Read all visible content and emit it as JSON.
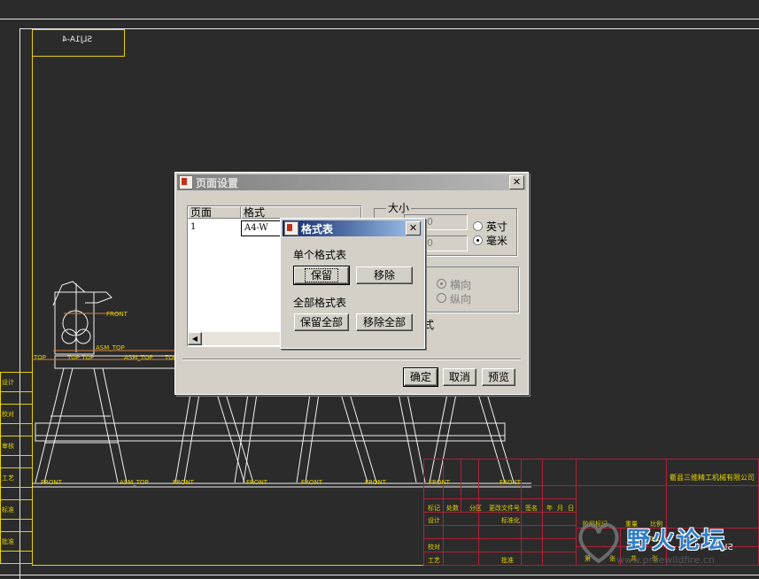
{
  "cad": {
    "drawing_name_box": "SLJ1A-4",
    "labels": {
      "front1": "FRONT",
      "asm_top1": "ASM_TOP",
      "top1": "TOP",
      "top_top": "TOP TOP",
      "asm_top2": "ASM_TOP",
      "top2": "TOP",
      "asm_top3": "ASM_TOP",
      "front2": "FRONT",
      "front3": "FRONT",
      "front4": "FRONT",
      "front5": "FRONT",
      "front6": "FRONT",
      "front7": "FRONT",
      "front8": "FRONT"
    },
    "left_title_block": [
      "设计",
      "校对",
      "审核",
      "工艺",
      "标准",
      "批准"
    ],
    "title_block": {
      "company": "衢县三维精工机械有限公司",
      "row_headers": [
        "标记",
        "处数",
        "分区",
        "更改文件号",
        "签名",
        "年",
        "月",
        "日"
      ],
      "design": "设计",
      "standardize": "标准化",
      "stage_mark": "阶段标记",
      "weight": "重量",
      "scale": "比例",
      "check": "校对",
      "process": "工艺",
      "approve": "批准",
      "sheets": "共",
      "sheet": "张",
      "sheet_label": "第",
      "sheet_label2": "张",
      "scale_value": "1:10",
      "drawing_number": "SLJ1A-4"
    }
  },
  "page_setup": {
    "title": "页面设置",
    "close": "✕",
    "table_headers": [
      "页面",
      "格式"
    ],
    "rows": [
      {
        "page": "1",
        "format": "A4-W"
      }
    ],
    "size_group": "大小",
    "width_value": "00",
    "height_value": "00",
    "unit_inch": "英寸",
    "unit_mm": "毫米",
    "orient_landscape": "横向",
    "orient_portrait": "纵向",
    "partial_label": "式",
    "ok": "确定",
    "cancel": "取消",
    "preview": "预览",
    "scroll_left": "◀"
  },
  "format_table": {
    "title": "格式表",
    "close": "✕",
    "single_label": "单个格式表",
    "keep": "保留",
    "remove": "移除",
    "all_label": "全部格式表",
    "keep_all": "保留全部",
    "remove_all": "移除全部"
  },
  "watermark": {
    "brand": "野火论坛",
    "url": "www.proewildfire.cn"
  }
}
